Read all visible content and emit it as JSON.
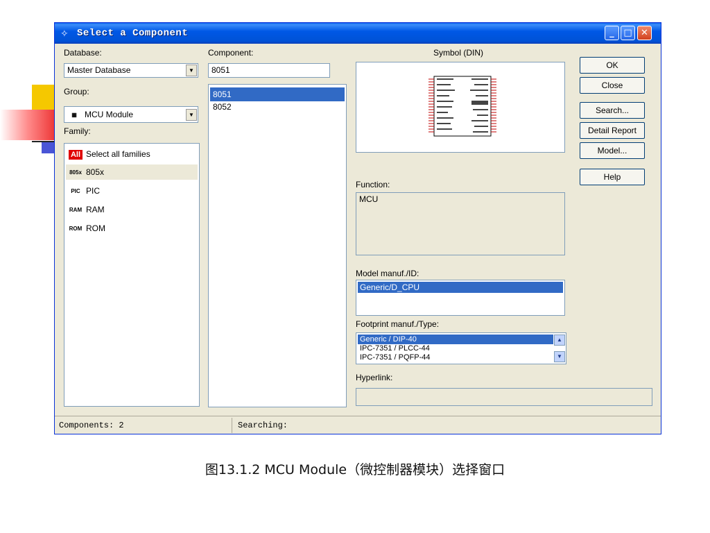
{
  "window": {
    "title": "Select a Component",
    "title_icon": "wand-icon",
    "controls": {
      "minimize": "_",
      "maximize": "□",
      "close": "✕"
    }
  },
  "left": {
    "database_label": "Database:",
    "database_value": "Master Database",
    "group_label": "Group:",
    "group_value": "MCU Module",
    "family_label": "Family:",
    "families": [
      {
        "icon": "All",
        "label": "Select all families"
      },
      {
        "icon": "805x",
        "label": "805x"
      },
      {
        "icon": "PIC",
        "label": "PIC"
      },
      {
        "icon": "RAM",
        "label": "RAM"
      },
      {
        "icon": "ROM",
        "label": "ROM"
      }
    ]
  },
  "component": {
    "label": "Component:",
    "value": "8051",
    "items": [
      "8051",
      "8052"
    ]
  },
  "right": {
    "symbol_label": "Symbol (DIN)",
    "function_label": "Function:",
    "function_value": "MCU",
    "model_label": "Model manuf./ID:",
    "model_items": [
      "Generic/D_CPU"
    ],
    "footprint_label": "Footprint manuf./Type:",
    "footprint_items": [
      "Generic / DIP-40",
      "IPC-7351 / PLCC-44",
      "IPC-7351 / PQFP-44"
    ],
    "hyperlink_label": "Hyperlink:"
  },
  "buttons": {
    "ok": "OK",
    "close": "Close",
    "search": "Search...",
    "detail_report": "Detail Report",
    "model": "Model...",
    "help": "Help"
  },
  "status": {
    "components": "Components: 2",
    "searching": "Searching:"
  },
  "caption": "图13.1.2 MCU Module（微控制器模块）选择窗口",
  "colors": {
    "selection": "#316ac5",
    "titlebar": "#0058e6",
    "window_bg": "#ece9d8"
  }
}
